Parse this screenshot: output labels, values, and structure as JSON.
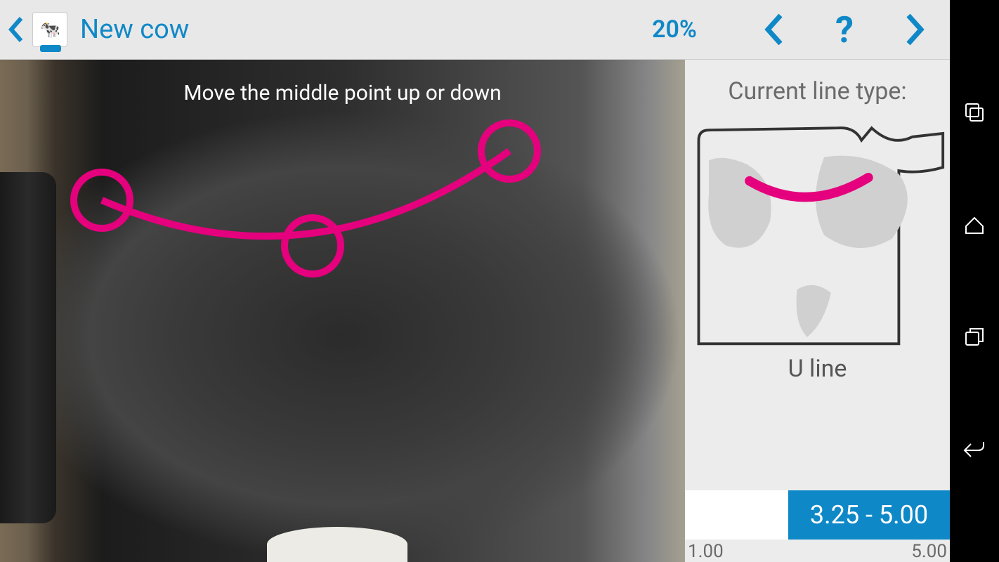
{
  "header": {
    "title": "New cow",
    "progress": "20%"
  },
  "photo": {
    "instruction": "Move the middle point up or down"
  },
  "side": {
    "label": "Current line type:",
    "line_name": "U line"
  },
  "range": {
    "selected_label": "3.25 - 5.00",
    "min": "1.00",
    "max": "5.00"
  },
  "colors": {
    "accent": "#0f88c7",
    "marker": "#e5007d"
  }
}
